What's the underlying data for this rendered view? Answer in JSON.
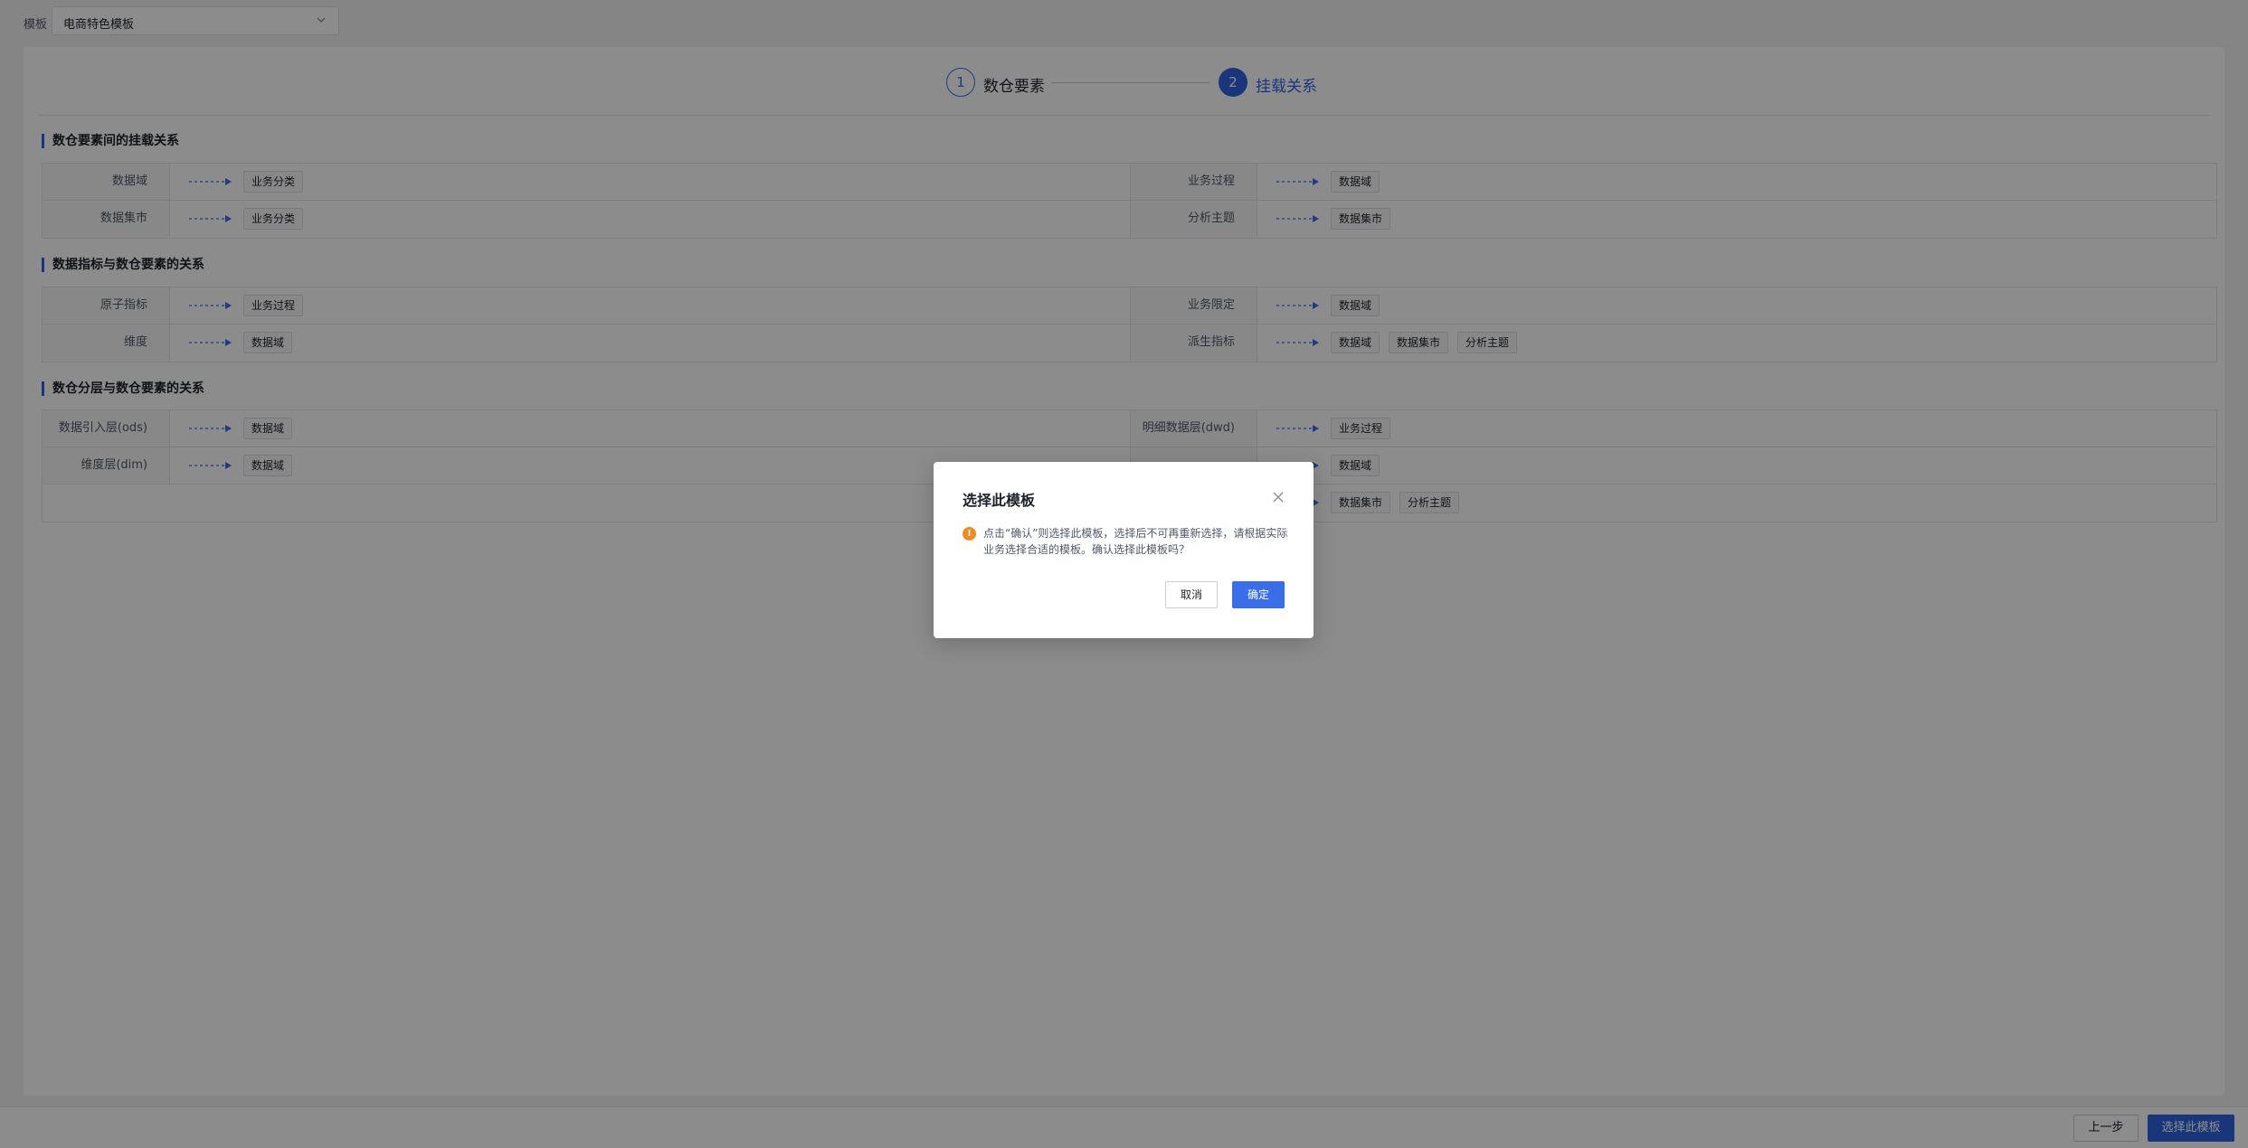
{
  "template": {
    "label": "模板",
    "selected": "电商特色模板"
  },
  "steps": [
    {
      "num": "1",
      "label": "数仓要素"
    },
    {
      "num": "2",
      "label": "挂载关系"
    }
  ],
  "sections": [
    {
      "title": "数仓要素间的挂载关系",
      "rows": [
        {
          "left": {
            "label": "数据域",
            "tags": [
              "业务分类"
            ]
          },
          "right": {
            "label": "业务过程",
            "tags": [
              "数据域"
            ]
          }
        },
        {
          "left": {
            "label": "数据集市",
            "tags": [
              "业务分类"
            ]
          },
          "right": {
            "label": "分析主题",
            "tags": [
              "数据集市"
            ]
          }
        }
      ]
    },
    {
      "title": "数据指标与数仓要素的关系",
      "rows": [
        {
          "left": {
            "label": "原子指标",
            "tags": [
              "业务过程"
            ]
          },
          "right": {
            "label": "业务限定",
            "tags": [
              "数据域"
            ]
          }
        },
        {
          "left": {
            "label": "维度",
            "tags": [
              "数据域"
            ]
          },
          "right": {
            "label": "派生指标",
            "tags": [
              "数据域",
              "数据集市",
              "分析主题"
            ]
          }
        }
      ]
    },
    {
      "title": "数仓分层与数仓要素的关系",
      "rows": [
        {
          "left": {
            "label": "数据引入层(ods)",
            "tags": [
              "数据域"
            ]
          },
          "right": {
            "label": "明细数据层(dwd)",
            "tags": [
              "业务过程"
            ]
          }
        },
        {
          "left": {
            "label": "维度层(dim)",
            "tags": [
              "数据域"
            ]
          },
          "right": {
            "label": "",
            "tags": [
              "数据域"
            ]
          }
        },
        {
          "left": null,
          "right": {
            "label": "",
            "tags": [
              "数据集市",
              "分析主题"
            ]
          }
        }
      ]
    }
  ],
  "footer": {
    "prev_label": "上一步",
    "choose_label": "选择此模板"
  },
  "modal": {
    "title": "选择此模板",
    "message": "点击“确认”则选择此模板，选择后不可再重新选择，请根据实际业务选择合适的模板。确认选择此模板吗？",
    "cancel_label": "取消",
    "ok_label": "确定"
  },
  "colors": {
    "primary": "#2f63e0",
    "warning": "#f08a24",
    "overlay": "rgba(0,0,0,0.45)"
  },
  "icons": {
    "select_arrow": "chevron-down-icon",
    "close": "close-icon",
    "warning": "exclamation-circle-icon",
    "relation": "dashed-arrow-icon"
  }
}
